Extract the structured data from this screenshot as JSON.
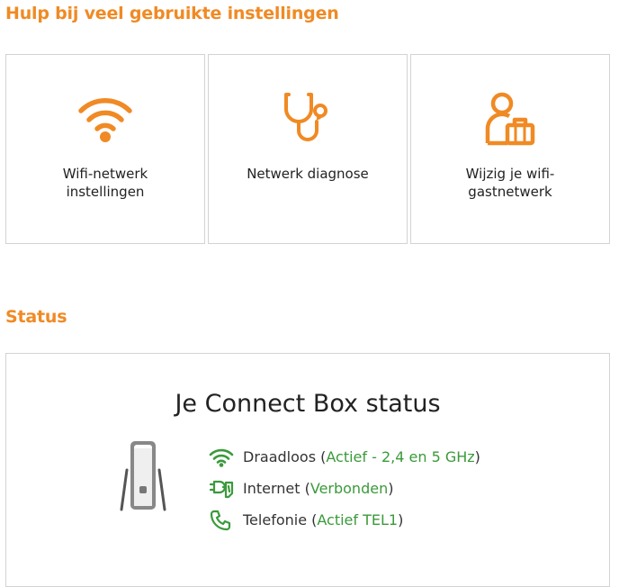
{
  "help": {
    "title": "Hulp bij veel gebruikte instellingen",
    "cards": [
      {
        "label": "Wifi-netwerk instellingen",
        "icon": "wifi-icon"
      },
      {
        "label": "Netwerk diagnose",
        "icon": "stethoscope-icon"
      },
      {
        "label": "Wijzig je wifi-gastnetwerk",
        "icon": "guest-luggage-icon"
      }
    ]
  },
  "status": {
    "title": "Status",
    "heading": "Je Connect Box status",
    "items": [
      {
        "name": "Draadloos",
        "value": "Actief - 2,4 en 5 GHz",
        "icon": "wifi-icon"
      },
      {
        "name": "Internet",
        "value": "Verbonden",
        "icon": "internet-plug-icon"
      },
      {
        "name": "Telefonie",
        "value": "Actief TEL1",
        "icon": "phone-icon"
      }
    ]
  },
  "colors": {
    "accent": "#f08a24",
    "status_green": "#3a9a3a",
    "border": "#d3d3d3"
  }
}
